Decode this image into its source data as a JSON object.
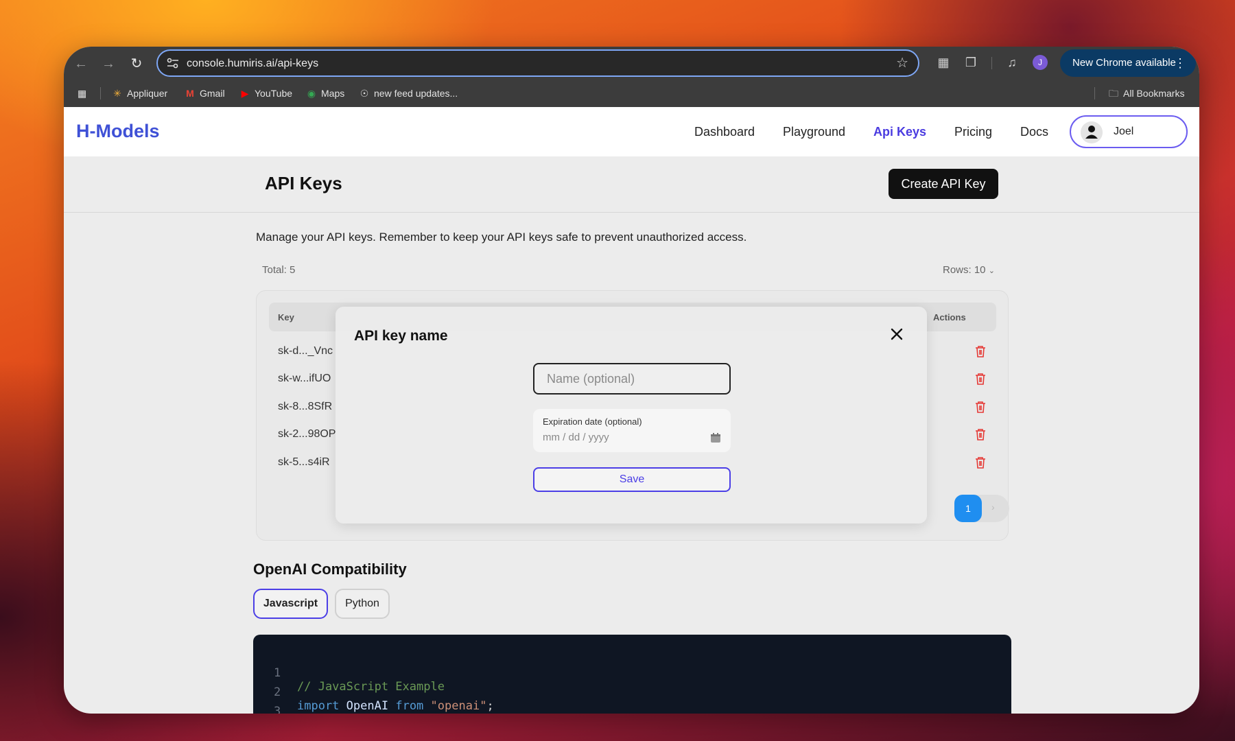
{
  "browser": {
    "url": "console.humiris.ai/api-keys",
    "new_chrome": "New Chrome available",
    "profile_initial": "J",
    "bookmarks": [
      {
        "label": "Appliquer",
        "icon": "sparkle-icon"
      },
      {
        "label": "Gmail",
        "icon": "gmail-icon"
      },
      {
        "label": "YouTube",
        "icon": "youtube-icon"
      },
      {
        "label": "Maps",
        "icon": "maps-icon"
      },
      {
        "label": "new feed updates...",
        "icon": "globe-icon"
      }
    ],
    "all_bookmarks": "All Bookmarks"
  },
  "header": {
    "logo": "H-Models",
    "nav": [
      "Dashboard",
      "Playground",
      "Api Keys",
      "Pricing",
      "Docs"
    ],
    "active_nav": "Api Keys",
    "user_name": "Joel"
  },
  "page": {
    "title": "API Keys",
    "create_button": "Create API Key",
    "description": "Manage your API keys. Remember to keep your API keys safe to prevent unauthorized access.",
    "total": "Total: 5",
    "rows": "Rows: 10"
  },
  "table": {
    "headers": {
      "key": "Key",
      "actions": "Actions"
    },
    "rows": [
      "sk-d..._Vnc",
      "sk-w...ifUO",
      "sk-8...8SfR",
      "sk-2...98OP",
      "sk-5...s4iR"
    ],
    "page": "1",
    "accent_color": "#1f8ef0",
    "delete_color": "#e53935"
  },
  "modal": {
    "title": "API key name",
    "name_placeholder": "Name (optional)",
    "expiration_label": "Expiration date (optional)",
    "date_placeholder": "mm / dd / yyyy",
    "save": "Save"
  },
  "compat": {
    "title": "OpenAI Compatibility",
    "tabs": [
      "Javascript",
      "Python"
    ],
    "active_tab": "Javascript",
    "code": {
      "line1_no": "1",
      "line1_comment": "// JavaScript Example",
      "line2_no": "2",
      "line2_import": "import",
      "line2_name": "OpenAI",
      "line2_from": "from",
      "line2_str": "\"openai\"",
      "line2_semi": ";",
      "line3_no": "3"
    }
  }
}
